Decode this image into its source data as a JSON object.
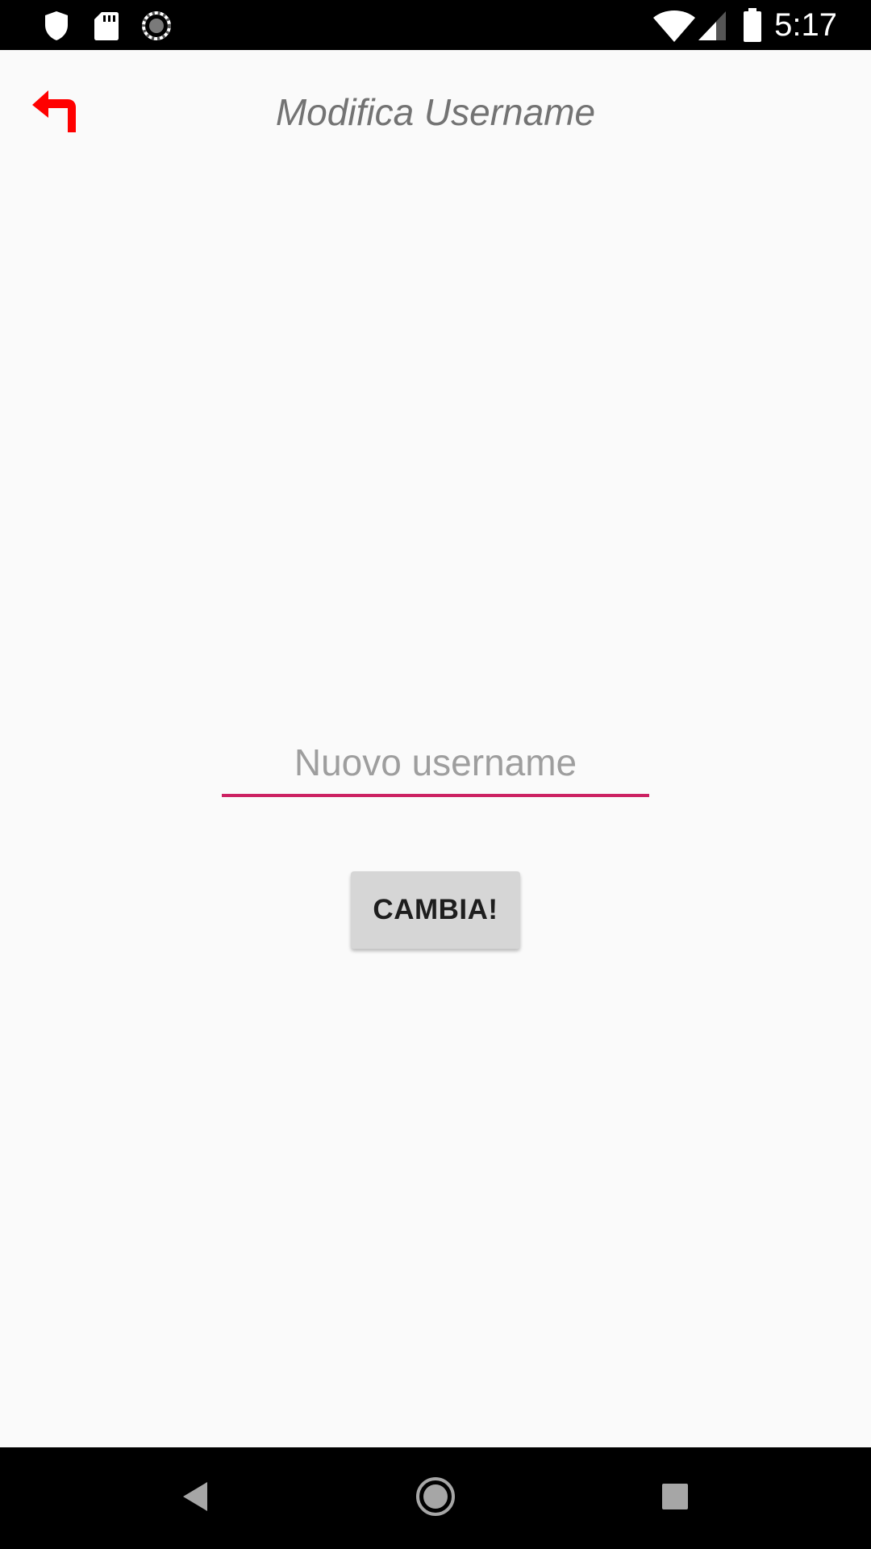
{
  "status_bar": {
    "time": "5:17",
    "left_icons": [
      "shield-icon",
      "sd-card-icon",
      "sync-icon"
    ],
    "right_icons": [
      "wifi-icon",
      "signal-icon",
      "battery-icon"
    ]
  },
  "header": {
    "title": "Modifica Username",
    "back_icon": "back-arrow-icon",
    "back_icon_color": "#ff0000"
  },
  "form": {
    "username_placeholder": "Nuovo username",
    "username_value": "",
    "underline_color": "#cc2162",
    "submit_label": "CAMBIA!"
  },
  "nav_bar": {
    "buttons": [
      "back-icon",
      "home-icon",
      "recents-icon"
    ]
  }
}
